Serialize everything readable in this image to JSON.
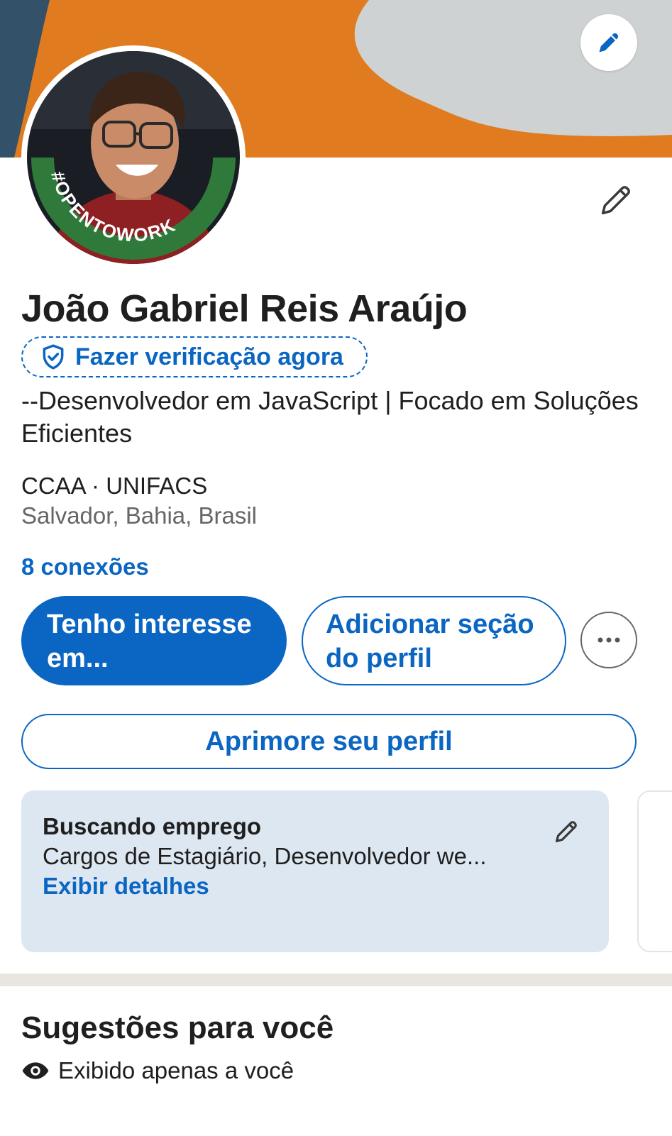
{
  "profile": {
    "name": "João Gabriel Reis Araújo",
    "verification_label": "Fazer verificação agora",
    "headline": "--Desenvolvedor em JavaScript | Focado em Soluções Eficientes",
    "education": "CCAA · UNIFACS",
    "location": "Salvador, Bahia, Brasil",
    "connections": "8 conexões",
    "open_to_work_badge": "#OPENTOWORK"
  },
  "actions": {
    "interest_label": "Tenho interesse em...",
    "add_section_label": "Adicionar seção do perfil",
    "improve_label": "Aprimore seu perfil"
  },
  "job_search": {
    "title": "Buscando emprego",
    "description": "Cargos de Estagiário, Desenvolvedor we...",
    "details_link": "Exibir detalhes"
  },
  "suggestions": {
    "title": "Sugestões para você",
    "visibility": "Exibido apenas a você"
  },
  "colors": {
    "accent": "#0a66c2",
    "open_to_work_green": "#2f7a3b",
    "banner_orange": "#e07c1f",
    "banner_gray": "#cfd2d3",
    "card_background": "#dde7f1"
  },
  "icons": {
    "banner_edit": "pencil-icon",
    "profile_edit": "pencil-icon",
    "verify": "shield-check-icon",
    "more": "ellipsis-icon",
    "card_edit": "pencil-icon",
    "visibility": "eye-icon"
  }
}
